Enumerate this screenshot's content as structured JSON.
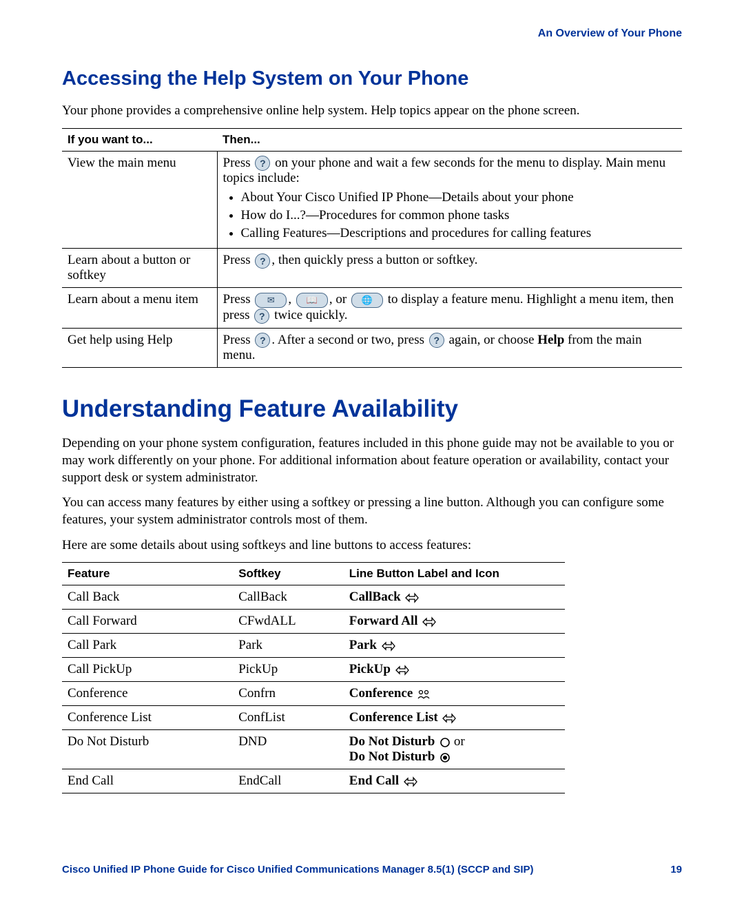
{
  "header": {
    "crumb": "An Overview of Your Phone"
  },
  "section1": {
    "heading": "Accessing the Help System on Your Phone",
    "intro": "Your phone provides a comprehensive online help system. Help topics appear on the phone screen."
  },
  "table1": {
    "headers": {
      "col1": "If you want to...",
      "col2": "Then..."
    },
    "rows": {
      "r0": {
        "want": "View the main menu",
        "then_pre": "Press ",
        "then_post": " on your phone and wait a few seconds for the menu to display. Main menu topics include:",
        "bullets": [
          "About Your Cisco Unified IP Phone—Details about your phone",
          "How do I...?—Procedures for common phone tasks",
          "Calling Features—Descriptions and procedures for calling features"
        ]
      },
      "r1": {
        "want": "Learn about a button or softkey",
        "then_pre": "Press ",
        "then_post": ", then quickly press a button or softkey."
      },
      "r2": {
        "want": "Learn about a menu item",
        "p1": "Press ",
        "p2": ", ",
        "p3": ", or ",
        "p4": " to display a feature menu. Highlight a menu item, then press ",
        "p5": " twice quickly."
      },
      "r3": {
        "want": "Get help using Help",
        "p1": "Press ",
        "p2": ". After a second or two, press ",
        "p3": " again, or choose ",
        "p4_bold": "Help",
        "p5": " from the main menu."
      }
    }
  },
  "section2": {
    "heading": "Understanding Feature Availability",
    "para1": "Depending on your phone system configuration, features included in this phone guide may not be available to you or may work differently on your phone. For additional information about feature operation or availability, contact your support desk or system administrator.",
    "para2": "You can access many features by either using a softkey or pressing a line button. Although you can configure some features, your system administrator controls most of them.",
    "para3": "Here are some details about using softkeys and line buttons to access features:"
  },
  "table2": {
    "headers": {
      "c1": "Feature",
      "c2": "Softkey",
      "c3": "Line Button Label and Icon"
    },
    "rows": [
      {
        "feature": "Call Back",
        "softkey": "CallBack",
        "label": "CallBack",
        "icon": "blf"
      },
      {
        "feature": "Call Forward",
        "softkey": "CFwdALL",
        "label": "Forward All",
        "icon": "blf"
      },
      {
        "feature": "Call Park",
        "softkey": "Park",
        "label": "Park",
        "icon": "blf"
      },
      {
        "feature": "Call PickUp",
        "softkey": "PickUp",
        "label": "PickUp",
        "icon": "blf"
      },
      {
        "feature": "Conference",
        "softkey": "Confrn",
        "label": "Conference",
        "icon": "conf"
      },
      {
        "feature": "Conference List",
        "softkey": "ConfList",
        "label": "Conference List",
        "icon": "blf"
      },
      {
        "feature": "Do Not Disturb",
        "softkey": "DND",
        "label_a": "Do Not Disturb",
        "mid": " or",
        "label_b": "Do Not Disturb",
        "icon": "dnd"
      },
      {
        "feature": "End Call",
        "softkey": "EndCall",
        "label": "End Call",
        "icon": "blf"
      }
    ]
  },
  "footer": {
    "title": "Cisco Unified IP Phone Guide for Cisco Unified Communications Manager 8.5(1) (SCCP and SIP)",
    "page": "19"
  },
  "icons": {
    "help": "?",
    "messages": "✉",
    "directories": "📖",
    "services": "🌐"
  }
}
